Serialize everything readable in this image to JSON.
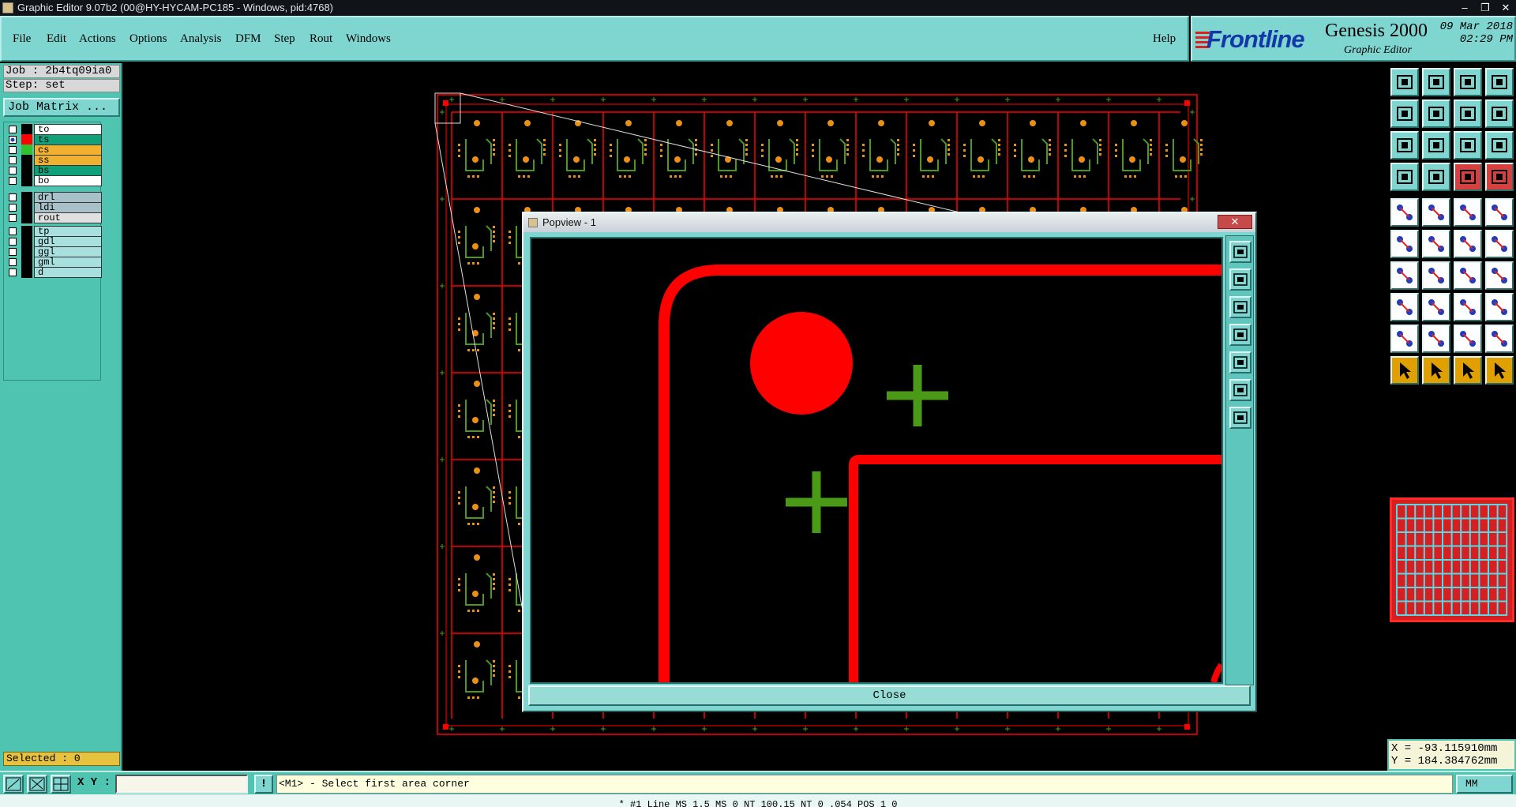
{
  "os_window": {
    "title": "Graphic Editor 9.07b2 (00@HY-HYCAM-PC185 - Windows, pid:4768)",
    "controls": [
      "–",
      "❐",
      "✕"
    ]
  },
  "menu": {
    "items": [
      "File",
      "Edit",
      "Actions",
      "Options",
      "Analysis",
      "DFM",
      "Step",
      "Rout",
      "Windows"
    ],
    "help": "Help"
  },
  "brand": {
    "logo": "Frontline",
    "product": "Genesis 2000",
    "subtitle": "Graphic Editor",
    "date": "09 Mar 2018",
    "time": "02:29 PM"
  },
  "job": {
    "job_label": "Job : 2b4tq09ia0",
    "step_label": "Step: set",
    "matrix_button": "Job Matrix ..."
  },
  "layers": [
    {
      "name": "to",
      "color": "#ffffff",
      "swatch": "#000000",
      "checked": false
    },
    {
      "name": "ts",
      "color": "#10a07a",
      "swatch": "#ff0000",
      "checked": true
    },
    {
      "name": "cs",
      "color": "#f0b030",
      "swatch": "#30c030",
      "checked": false
    },
    {
      "name": "ss",
      "color": "#f0b030",
      "swatch": "#000000",
      "checked": false
    },
    {
      "name": "bs",
      "color": "#10a07a",
      "swatch": "#000000",
      "checked": false
    },
    {
      "name": "bo",
      "color": "#ffffff",
      "swatch": "#000000",
      "checked": false
    },
    {
      "name": "drl",
      "color": "#a8c0c8",
      "swatch": "#000000",
      "checked": false
    },
    {
      "name": "ldi",
      "color": "#a8c0c8",
      "swatch": "#000000",
      "checked": false
    },
    {
      "name": "rout",
      "color": "#e0e0e0",
      "swatch": "#000000",
      "checked": false
    },
    {
      "name": "tp",
      "color": "#a8e0e0",
      "swatch": "#000000",
      "checked": false
    },
    {
      "name": "gdl",
      "color": "#a8e0e0",
      "swatch": "#000000",
      "checked": false
    },
    {
      "name": "ggl",
      "color": "#a8e0e0",
      "swatch": "#000000",
      "checked": false
    },
    {
      "name": "gml",
      "color": "#a8e0e0",
      "swatch": "#000000",
      "checked": false
    },
    {
      "name": "d",
      "color": "#a8e0e0",
      "swatch": "#000000",
      "checked": false
    }
  ],
  "selected_label": "Selected : 0",
  "popview": {
    "title": "Popview - 1",
    "close_x": "✕",
    "close_button": "Close"
  },
  "coords": {
    "x": "X = -93.115910mm",
    "y": "Y = 184.384762mm"
  },
  "statusbar": {
    "xy_label": "X Y :",
    "xy_value": "",
    "excl": "!",
    "prompt": "<M1> - Select first area corner",
    "units": "MM"
  },
  "bottom_text": "* #1 Line MS 1.5 MS 0 NT 100.15 NT 0 .054 POS 1 0",
  "colors": {
    "panel": "#4fc4b0",
    "menu": "#7fd6d0",
    "copper": "#ff0000",
    "silkscreen": "#4a9a18",
    "pad": "#e8901a"
  },
  "icons": {
    "toolbox_top": [
      "open-job-icon",
      "save-icon",
      "home-icon",
      "window-split-icon",
      "step-in-icon",
      "step-out-icon",
      "loop-icon",
      "snake-icon",
      "fit-icon",
      "zoom-center-icon",
      "scale-ratio-icon",
      "help-icon",
      "measure-icon",
      "pin-icon",
      "layer-board-icon",
      "layer-stack-icon"
    ],
    "toolbox_bottom": [
      "add-pad-icon",
      "cut-icon",
      "ruler-icon",
      "circle-icon",
      "net-icon",
      "cross-icon",
      "connect-icon",
      "node-icon",
      "line-red-icon",
      "line-blue-icon",
      "arc-icon",
      "step-repeat-icon",
      "snap-icon",
      "minus-icon",
      "dimension-icon",
      "group-icon",
      "triangle-icon",
      "peak-icon",
      "arch-icon",
      "bridge-icon",
      "select-arrow-icon",
      "select-box-icon",
      "select-poly-icon",
      "route-icon"
    ]
  }
}
